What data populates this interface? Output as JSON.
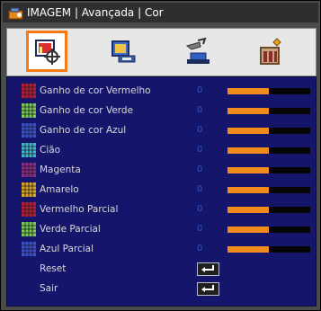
{
  "window": {
    "title": "IMAGEM | Avançada | Cor"
  },
  "toolbar": {
    "icons": [
      {
        "name": "image-settings-icon",
        "selected": true
      },
      {
        "name": "display-settings-icon",
        "selected": false
      },
      {
        "name": "setup-settings-icon",
        "selected": false
      },
      {
        "name": "options-settings-icon",
        "selected": false
      }
    ]
  },
  "accent_color": "#f47b16",
  "menu": {
    "items": [
      {
        "label": "Ganho de cor Vermelho",
        "value": "0",
        "level": 0.5,
        "swatch": "red"
      },
      {
        "label": "Ganho de cor Verde",
        "value": "0",
        "level": 0.5,
        "swatch": "green"
      },
      {
        "label": "Ganho de cor Azul",
        "value": "0",
        "level": 0.5,
        "swatch": "blue"
      },
      {
        "label": "Cião",
        "value": "0",
        "level": 0.5,
        "swatch": "cyan"
      },
      {
        "label": "Magenta",
        "value": "0",
        "level": 0.5,
        "swatch": "magenta"
      },
      {
        "label": "Amarelo",
        "value": "0",
        "level": 0.5,
        "swatch": "yellow"
      },
      {
        "label": "Vermelho Parcial",
        "value": "0",
        "level": 0.5,
        "swatch": "red"
      },
      {
        "label": "Verde Parcial",
        "value": "0",
        "level": 0.5,
        "swatch": "green"
      },
      {
        "label": "Azul Parcial",
        "value": "0",
        "level": 0.5,
        "swatch": "blue"
      }
    ],
    "actions": [
      {
        "label": "Reset",
        "icon": "enter-icon"
      },
      {
        "label": "Sair",
        "icon": "enter-icon"
      }
    ]
  },
  "swatch_colors": {
    "red": "#b71d3a",
    "green": "#78c85a",
    "blue": "#3a4fd0",
    "cyan": "#3fb4d2",
    "magenta": "#8a2c8c",
    "yellow": "#d8a326"
  }
}
